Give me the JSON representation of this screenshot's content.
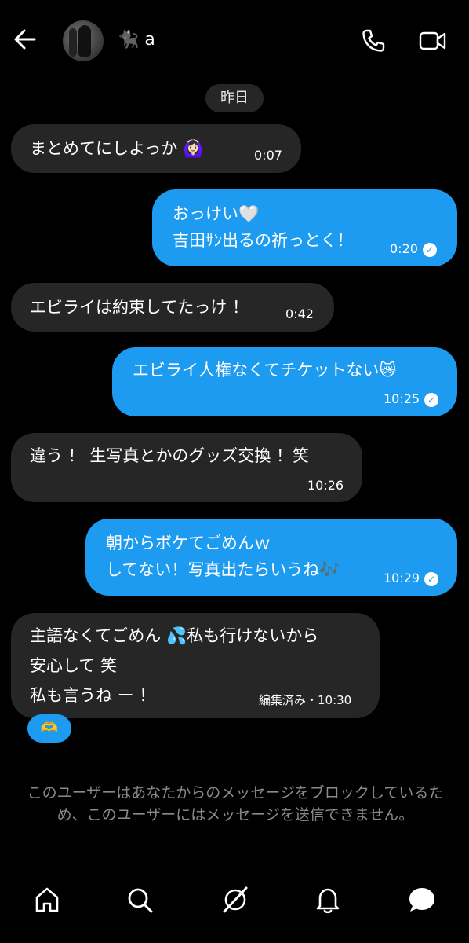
{
  "header": {
    "name_emoji": "🐈‍⬛",
    "name": "a"
  },
  "date_divider": "昨日",
  "messages": [
    {
      "lines": [
        "まとめてにしよっか 🙆🏻‍♀️"
      ],
      "time": "0:07"
    },
    {
      "lines": [
        "おっけい🤍",
        "吉田ｻﾝ出るの祈っとく！"
      ],
      "time": "0:20"
    },
    {
      "lines": [
        "エビライは約束してたっけ ！"
      ],
      "time": "0:42"
    },
    {
      "lines": [
        "エビライ人権なくてチケットない😿"
      ],
      "time": "10:25"
    },
    {
      "lines": [
        "違う ！ 生写真とかのグッズ交換 ！笑"
      ],
      "time": "10:26"
    },
    {
      "lines": [
        "朝からボケてごめんｗ",
        "してない！写真出たらいうね🎶"
      ],
      "time": "10:29"
    },
    {
      "lines": [
        "主語なくてごめん 💦私も行けないから",
        "安心して 笑",
        "私も言うね ー ！"
      ],
      "time": "編集済み・10:30"
    }
  ],
  "reaction": "🫶",
  "block_notice": "このユーザーはあなたからのメッセージをブロックしているため、このユーザーにはメッセージを送信できません。",
  "colors": {
    "outgoing": "#1d9bf0",
    "incoming": "#262626",
    "background": "#000000"
  }
}
